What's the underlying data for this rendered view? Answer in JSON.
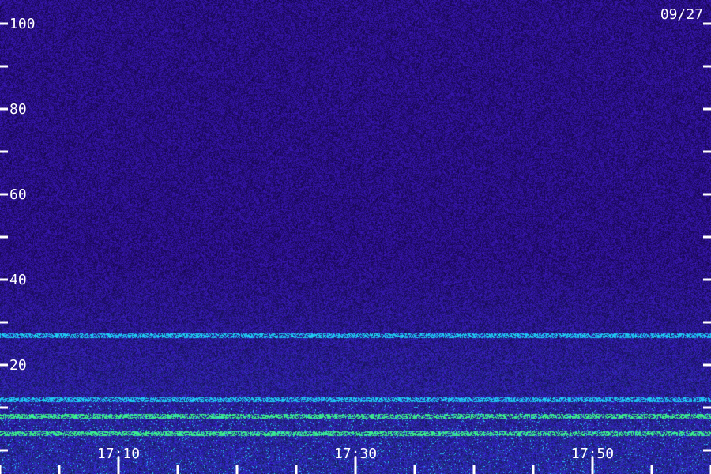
{
  "chart_data": {
    "type": "heatmap",
    "date_label": "09/27",
    "y_axis": {
      "range": [
        0,
        100
      ],
      "tick_labels": [
        "100",
        "80",
        "60",
        "40",
        "20"
      ],
      "label_values": [
        100,
        80,
        60,
        40,
        20
      ],
      "minor_tick_values": [
        90,
        70,
        50,
        30,
        10,
        0
      ]
    },
    "x_axis": {
      "range": [
        "17:05",
        "17:55"
      ],
      "tick_labels": [
        "17:10",
        "17:30",
        "17:50"
      ],
      "minor_tick_count_per_major": 3
    },
    "colors": {
      "background": "#1a0c5c",
      "low": "#2a10a0",
      "mid": "#3050ff",
      "high": "#20c8ff",
      "peak": "#40ff80",
      "text": "#ffffff"
    },
    "bands": [
      {
        "y_value": 27,
        "intensity": "high"
      },
      {
        "y_value": 8,
        "intensity": "peak"
      },
      {
        "y_value": 12,
        "intensity": "high"
      },
      {
        "y_value": 4,
        "intensity": "peak"
      }
    ]
  }
}
